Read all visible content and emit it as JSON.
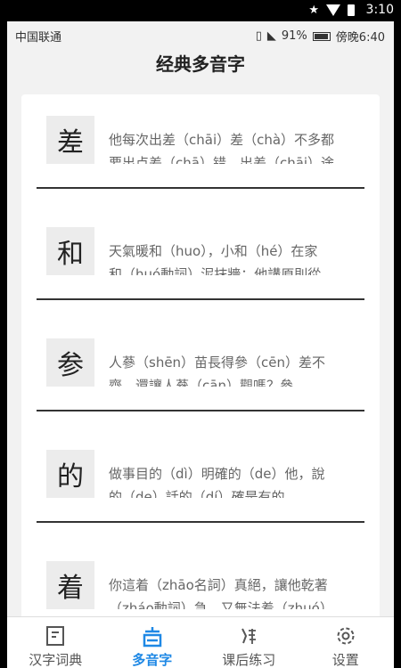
{
  "system": {
    "time": "3:10"
  },
  "status": {
    "carrier": "中国联通",
    "battery": "91%",
    "clock": "傍晚6:40"
  },
  "page": {
    "title": "经典多音字"
  },
  "entries": [
    {
      "char": "差",
      "line1": "他每次出差（chāi）差（chà）不多都",
      "line2": "要出点差（chā）错，出差（chāi）途"
    },
    {
      "char": "和",
      "line1": "天氣暖和（huo），小和（hé）在家",
      "line2": "和（huó動詞）泥抹牆；他講原則從"
    },
    {
      "char": "参",
      "line1": "人蔘（shēn）苗長得參（cēn）差不",
      "line2": "齊，還讓人蔘（cān）觀嗎？參"
    },
    {
      "char": "的",
      "line1": "做事目的（dì）明確的（de）他，說",
      "line2": "的（de）話的（dí）確是有的"
    },
    {
      "char": "着",
      "line1": "你這着（zhāo名詞）真絕，讓他乾著",
      "line2": "（zháo動詞）急，又無法着（zhuó）"
    }
  ],
  "tabs": [
    {
      "label": "汉字词典",
      "icon": "dictionary-icon",
      "active": false
    },
    {
      "label": "多音字",
      "icon": "polyphonic-icon",
      "active": true
    },
    {
      "label": "课后练习",
      "icon": "brush-character-icon",
      "active": false
    },
    {
      "label": "设置",
      "icon": "gear-icon",
      "active": false
    }
  ],
  "colors": {
    "accent": "#1e88e5",
    "background": "#f2f2f2",
    "card": "#ffffff"
  }
}
